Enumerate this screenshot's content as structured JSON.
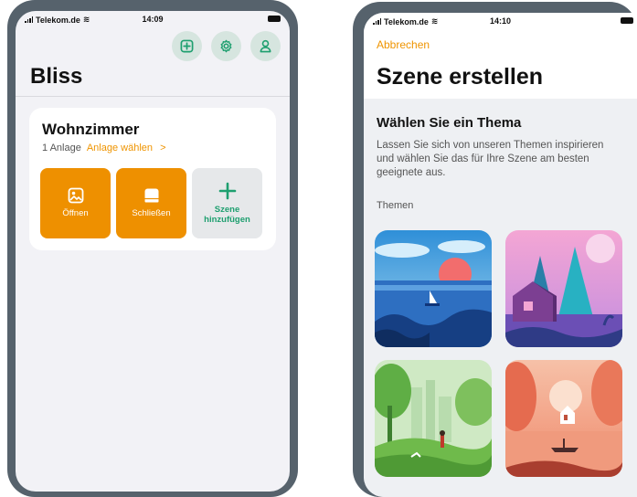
{
  "left_screen": {
    "status": {
      "carrier": "Telekom.de",
      "time": "14:09"
    },
    "title": "Bliss",
    "room": {
      "name": "Wohnzimmer",
      "count": "1 Anlage",
      "select_link": "Anlage wählen",
      "chevron": ">"
    },
    "scenes": [
      {
        "label": "Öffnen",
        "icon": "open-scene-icon"
      },
      {
        "label": "Schließen",
        "icon": "close-scene-icon"
      },
      {
        "label": "Szene hinzufügen",
        "icon": "plus-icon"
      }
    ],
    "top_icons": [
      "add-icon",
      "gear-icon",
      "user-icon"
    ]
  },
  "right_screen": {
    "status": {
      "carrier": "Telekom.de",
      "time": "14:10"
    },
    "cancel": "Abbrechen",
    "title": "Szene erstellen",
    "heading": "Wählen Sie ein Thema",
    "description": "Lassen Sie sich von unseren Themen inspirieren und wählen Sie das für Ihre Szene am besten geeignete aus.",
    "themes_label": "Themen",
    "themes": [
      {
        "name": "sea-sunset-theme"
      },
      {
        "name": "lake-house-theme"
      },
      {
        "name": "city-park-theme"
      },
      {
        "name": "autumn-lake-theme"
      }
    ]
  },
  "colors": {
    "accent_orange": "#EE9000",
    "accent_green": "#1E9F6F",
    "frame": "#56626C",
    "background": "#F2F2F6"
  }
}
